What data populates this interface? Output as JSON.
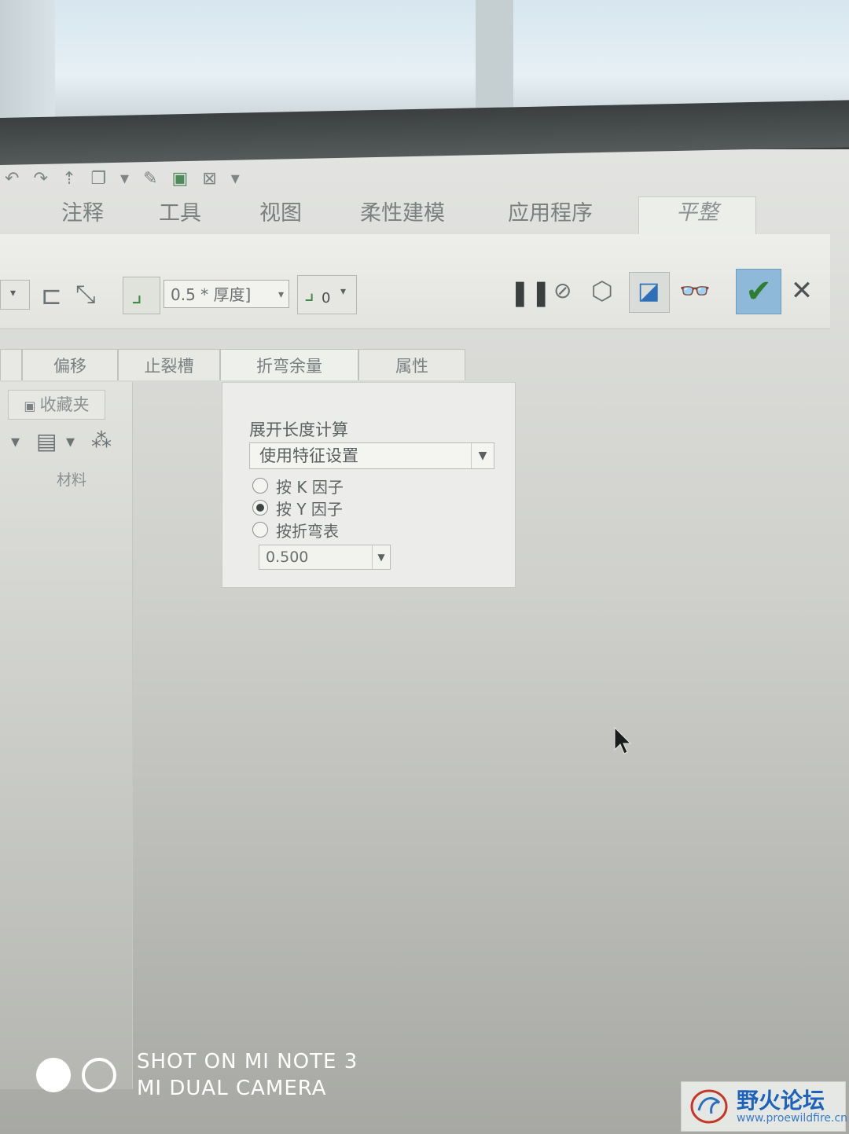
{
  "ribbon_tabs": [
    "注释",
    "工具",
    "视图",
    "柔性建模",
    "应用程序"
  ],
  "active_tab": "平整",
  "toolbar": {
    "thickness_value": "0.5 * 厚度]",
    "bend_value": "0"
  },
  "sub_tabs": [
    "偏移",
    "止裂槽",
    "折弯余量",
    "属性"
  ],
  "panel": {
    "title": "展开长度计算",
    "method_value": "使用特征设置",
    "options": [
      "按 K 因子",
      "按 Y 因子",
      "按折弯表"
    ],
    "selected_option": "按 Y 因子",
    "factor_value": "0.500"
  },
  "left_panel": {
    "favorites": "收藏夹",
    "material_header": "材料"
  },
  "camera_watermark": {
    "line1": "SHOT ON MI NOTE 3",
    "line2": "MI DUAL CAMERA"
  },
  "forum_logo": {
    "name": "野火论坛",
    "url": "www.proewildfire.cn"
  },
  "colors": {
    "ok_green": "#2e7d32",
    "ok_bg": "#8fb9d8",
    "logo_blue": "#1e63b8"
  }
}
